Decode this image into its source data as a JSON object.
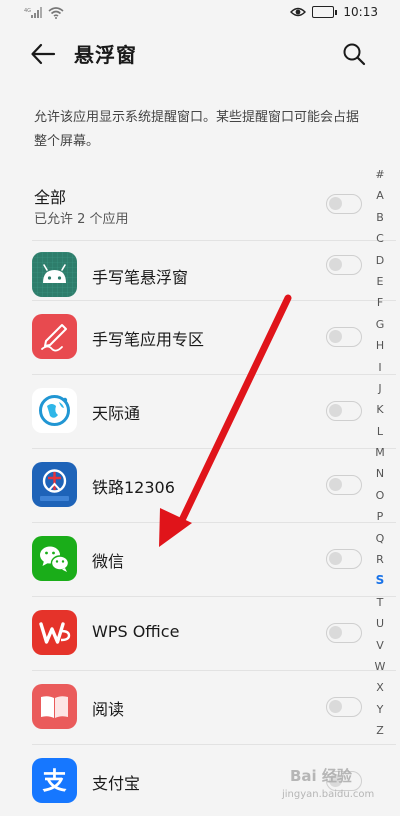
{
  "status_bar": {
    "network": "4G",
    "time": "10:13"
  },
  "header": {
    "title": "悬浮窗"
  },
  "description": "允许该应用显示系统提醒窗口。某些提醒窗口可能会占据整个屏幕。",
  "all": {
    "title": "全部",
    "subtitle": "已允许 2 个应用",
    "enabled": false
  },
  "apps": [
    {
      "name": "手写笔悬浮窗",
      "icon": "android-icon",
      "enabled": false
    },
    {
      "name": "手写笔应用专区",
      "icon": "stylus-icon",
      "enabled": false
    },
    {
      "name": "天际通",
      "icon": "globe-icon",
      "enabled": false
    },
    {
      "name": "铁路12306",
      "icon": "railway-icon",
      "enabled": false
    },
    {
      "name": "微信",
      "icon": "wechat-icon",
      "enabled": false
    },
    {
      "name": "WPS Office",
      "icon": "wps-icon",
      "enabled": false
    },
    {
      "name": "阅读",
      "icon": "book-icon",
      "enabled": false
    },
    {
      "name": "支付宝",
      "icon": "alipay-icon",
      "enabled": false
    }
  ],
  "alpha_index": {
    "letters": [
      "#",
      "A",
      "B",
      "C",
      "D",
      "E",
      "F",
      "G",
      "H",
      "I",
      "J",
      "K",
      "L",
      "M",
      "N",
      "O",
      "P",
      "Q",
      "R",
      "S",
      "T",
      "U",
      "V",
      "W",
      "X",
      "Y",
      "Z"
    ],
    "active": "S"
  },
  "colors": {
    "annotation_arrow": "#e0141a",
    "active_index": "#1a73e8"
  },
  "watermark": {
    "text": "Bai 经验",
    "url": "jingyan.baidu.com"
  }
}
